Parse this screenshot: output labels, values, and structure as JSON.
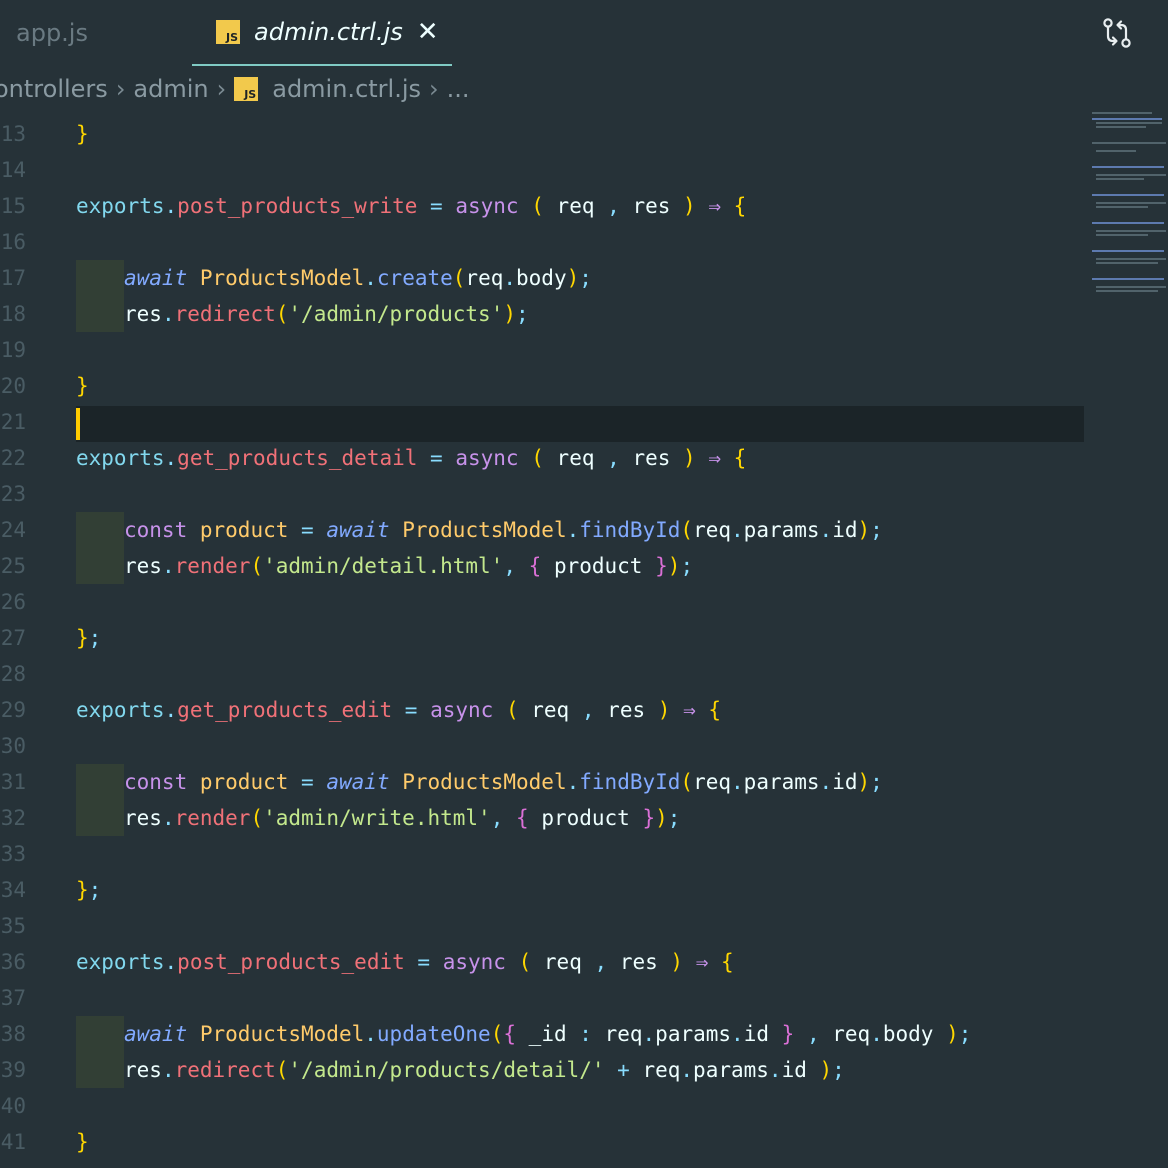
{
  "tabs": [
    {
      "name": "app.js",
      "active": false
    },
    {
      "name": "admin.ctrl.js",
      "active": true,
      "icon_label": "JS"
    }
  ],
  "breadcrumb": {
    "root": "ontrollers",
    "folder": "admin",
    "icon_label": "JS",
    "file": "admin.ctrl.js",
    "more": "..."
  },
  "editor": {
    "cursor_line": 21,
    "colors": {
      "background": "#263238",
      "cursor": "#ffcc00",
      "current_line": "#1b2428"
    },
    "lines": [
      {
        "n": "13",
        "code": "}"
      },
      {
        "n": "14",
        "code": ""
      },
      {
        "n": "15",
        "code": "exports.post_products_write = async ( req , res ) ⇒ {"
      },
      {
        "n": "16",
        "code": ""
      },
      {
        "n": "17",
        "code": "await ProductsModel.create(req.body);"
      },
      {
        "n": "18",
        "code": "res.redirect('/admin/products');"
      },
      {
        "n": "19",
        "code": ""
      },
      {
        "n": "20",
        "code": "}"
      },
      {
        "n": "21",
        "code": ""
      },
      {
        "n": "22",
        "code": "exports.get_products_detail = async ( req , res ) ⇒ {"
      },
      {
        "n": "23",
        "code": ""
      },
      {
        "n": "24",
        "code": "const product = await ProductsModel.findById(req.params.id);"
      },
      {
        "n": "25",
        "code": "res.render('admin/detail.html', { product });"
      },
      {
        "n": "26",
        "code": ""
      },
      {
        "n": "27",
        "code": "};"
      },
      {
        "n": "28",
        "code": ""
      },
      {
        "n": "29",
        "code": "exports.get_products_edit = async ( req , res ) ⇒ {"
      },
      {
        "n": "30",
        "code": ""
      },
      {
        "n": "31",
        "code": "const product = await ProductsModel.findById(req.params.id);"
      },
      {
        "n": "32",
        "code": "res.render('admin/write.html', { product });"
      },
      {
        "n": "33",
        "code": ""
      },
      {
        "n": "34",
        "code": "};"
      },
      {
        "n": "35",
        "code": ""
      },
      {
        "n": "36",
        "code": "exports.post_products_edit = async ( req , res ) ⇒ {"
      },
      {
        "n": "37",
        "code": ""
      },
      {
        "n": "38",
        "code": "await ProductsModel.updateOne({ _id : req.params.id } , req.body );"
      },
      {
        "n": "39",
        "code": "res.redirect('/admin/products/detail/' + req.params.id );"
      },
      {
        "n": "40",
        "code": ""
      },
      {
        "n": "41",
        "code": "}"
      }
    ]
  }
}
